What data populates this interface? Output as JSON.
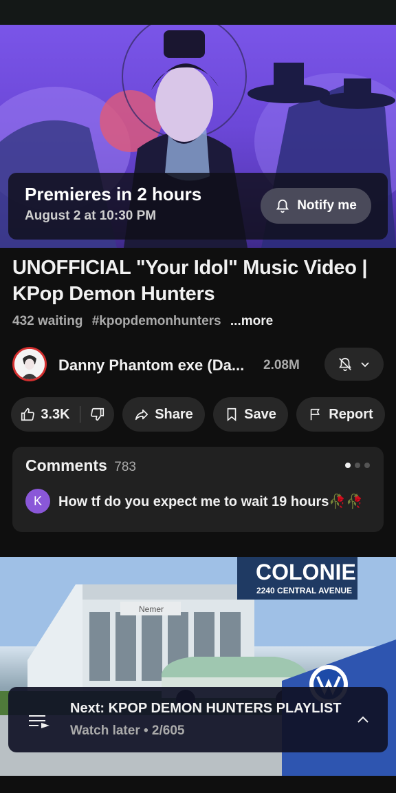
{
  "player": {
    "premiere_title": "Premieres in 2 hours",
    "premiere_date": "August 2 at 10:30 PM",
    "notify_label": "Notify me"
  },
  "video": {
    "title": "UNOFFICIAL \"Your Idol\" Music Video | KPop Demon Hunters",
    "waiting": "432 waiting",
    "hashtag": "#kpopdemonhunters",
    "more": "...more"
  },
  "channel": {
    "name": "Danny Phantom exe (Da...",
    "subscribers": "2.08M"
  },
  "actions": {
    "likes": "3.3K",
    "share": "Share",
    "save": "Save",
    "report": "Report"
  },
  "comments": {
    "heading": "Comments",
    "count": "783",
    "top_avatar_letter": "K",
    "top_comment": "How tf do you expect me to wait 19 hours🥀🥀"
  },
  "thumbnail": {
    "sign_title": "COLONIE",
    "sign_address": "2240 CENTRAL AVENUE",
    "building_sign": "Nemer"
  },
  "next": {
    "title": "Next: KPOP DEMON HUNTERS PLAYLIST",
    "subtitle": "Watch later • 2/605"
  },
  "colors": {
    "background": "#0f0f0f",
    "chip": "#272727",
    "card": "#212121",
    "avatar_ring": "#d32f2f",
    "comment_avatar": "#8a57d8"
  }
}
